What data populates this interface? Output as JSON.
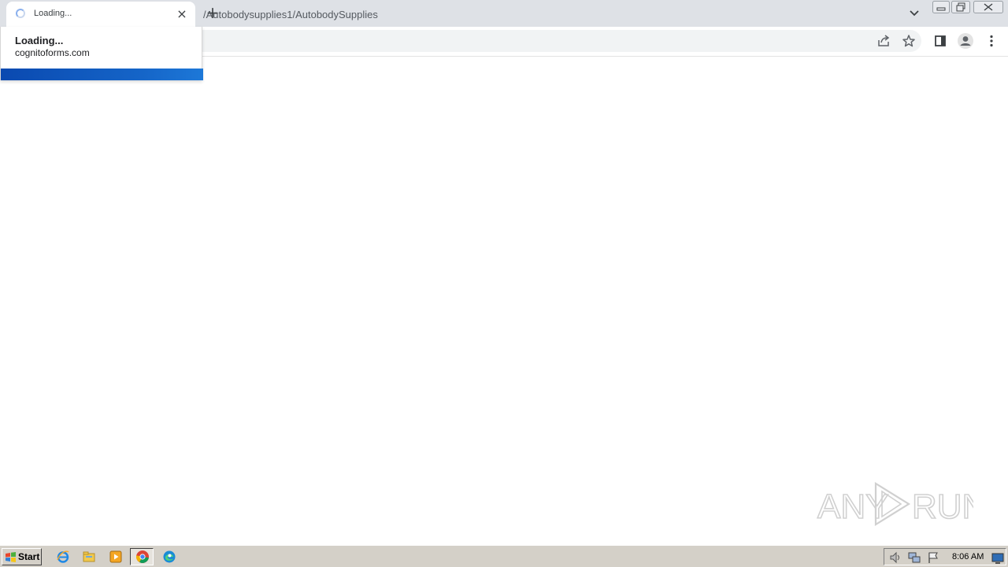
{
  "browser": {
    "tab": {
      "title": "Loading...",
      "close_glyph": "×"
    },
    "new_tab_glyph": "+",
    "address_bar": {
      "url_visible": "/Autobodysupplies1/AutobodySupplies"
    },
    "toolbar_icons": [
      "share-icon",
      "bookmark-star-icon",
      "side-panel-icon",
      "profile-icon",
      "menu-icon"
    ],
    "hover_card": {
      "title": "Loading...",
      "domain": "cognitoforms.com"
    }
  },
  "watermark": {
    "text": "ANY RUN"
  },
  "taskbar": {
    "start_label": "Start",
    "quick_launch": [
      "ie-icon",
      "explorer-icon",
      "media-player-icon",
      "chrome-icon",
      "edge-icon"
    ],
    "tray_icons": [
      "volume-icon",
      "network-icon",
      "action-center-flag-icon"
    ],
    "clock": "8:06 AM"
  },
  "colors": {
    "tabstrip_bg": "#dee1e6",
    "taskbar_bg": "#d4d0c8",
    "preview_blue": "#1565c8"
  }
}
